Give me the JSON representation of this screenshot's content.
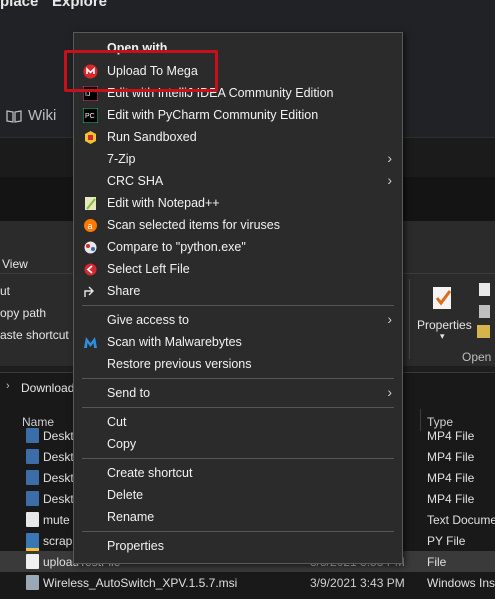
{
  "browser": {
    "nav_left": "place",
    "nav_right": "Explore",
    "wiki_label": "Wiki"
  },
  "ribbon": {
    "view_tab": "View",
    "cut": "ut",
    "copy_path": "opy path",
    "paste_shortcut": "aste shortcut",
    "properties_label": "Properties",
    "open_group": "Open"
  },
  "address": {
    "breadcrumb": "Download"
  },
  "filelist": {
    "columns": {
      "name": "Name",
      "date": "",
      "type": "Type"
    },
    "rows": [
      {
        "name": "Deskt",
        "date": "",
        "type": "MP4 File"
      },
      {
        "name": "Deskt",
        "date": "",
        "type": "MP4 File"
      },
      {
        "name": "Deskt",
        "date": "",
        "type": "MP4 File"
      },
      {
        "name": "Deskt",
        "date": "",
        "type": "MP4 File"
      },
      {
        "name": "mute",
        "date": "",
        "type": "Text Docume"
      },
      {
        "name": "scrap",
        "date": "",
        "type": "PY File"
      },
      {
        "name": "uploadTestFile",
        "date": "3/8/2021 3:53 PM",
        "type": "File"
      },
      {
        "name": "Wireless_AutoSwitch_XPV.1.5.7.msi",
        "date": "3/9/2021 3:43 PM",
        "type": "Windows Inst"
      }
    ]
  },
  "context_menu": {
    "items": [
      {
        "label": "Open with",
        "icon": "",
        "bold": true
      },
      {
        "label": "Upload To Mega",
        "icon": "mega-icon"
      },
      {
        "label": "Edit with IntelliJ IDEA Community Edition",
        "icon": "intellij-icon"
      },
      {
        "label": "Edit with PyCharm Community Edition",
        "icon": "pycharm-icon"
      },
      {
        "label": "Run Sandboxed",
        "icon": "sandboxie-icon"
      },
      {
        "label": "7-Zip",
        "icon": "",
        "submenu": true
      },
      {
        "label": "CRC SHA",
        "icon": "",
        "submenu": true
      },
      {
        "label": "Edit with Notepad++",
        "icon": "notepadpp-icon"
      },
      {
        "label": "Scan selected items for viruses",
        "icon": "avast-icon"
      },
      {
        "label": "Compare to \"python.exe\"",
        "icon": "winmerge-icon"
      },
      {
        "label": "Select Left File",
        "icon": "winmerge-left-icon"
      },
      {
        "label": "Share",
        "icon": "share-icon"
      },
      {
        "label": "Give access to",
        "icon": "",
        "submenu": true
      },
      {
        "label": "Scan with Malwarebytes",
        "icon": "malwarebytes-icon"
      },
      {
        "label": "Restore previous versions",
        "icon": ""
      },
      {
        "label": "Send to",
        "icon": "",
        "submenu": true
      },
      {
        "label": "Cut",
        "icon": ""
      },
      {
        "label": "Copy",
        "icon": ""
      },
      {
        "label": "Create shortcut",
        "icon": ""
      },
      {
        "label": "Delete",
        "icon": ""
      },
      {
        "label": "Rename",
        "icon": ""
      },
      {
        "label": "Properties",
        "icon": ""
      }
    ]
  },
  "colors": {
    "highlight": "#c8101a",
    "menu_bg": "#2b2b2b",
    "mega_red": "#d9272e"
  }
}
